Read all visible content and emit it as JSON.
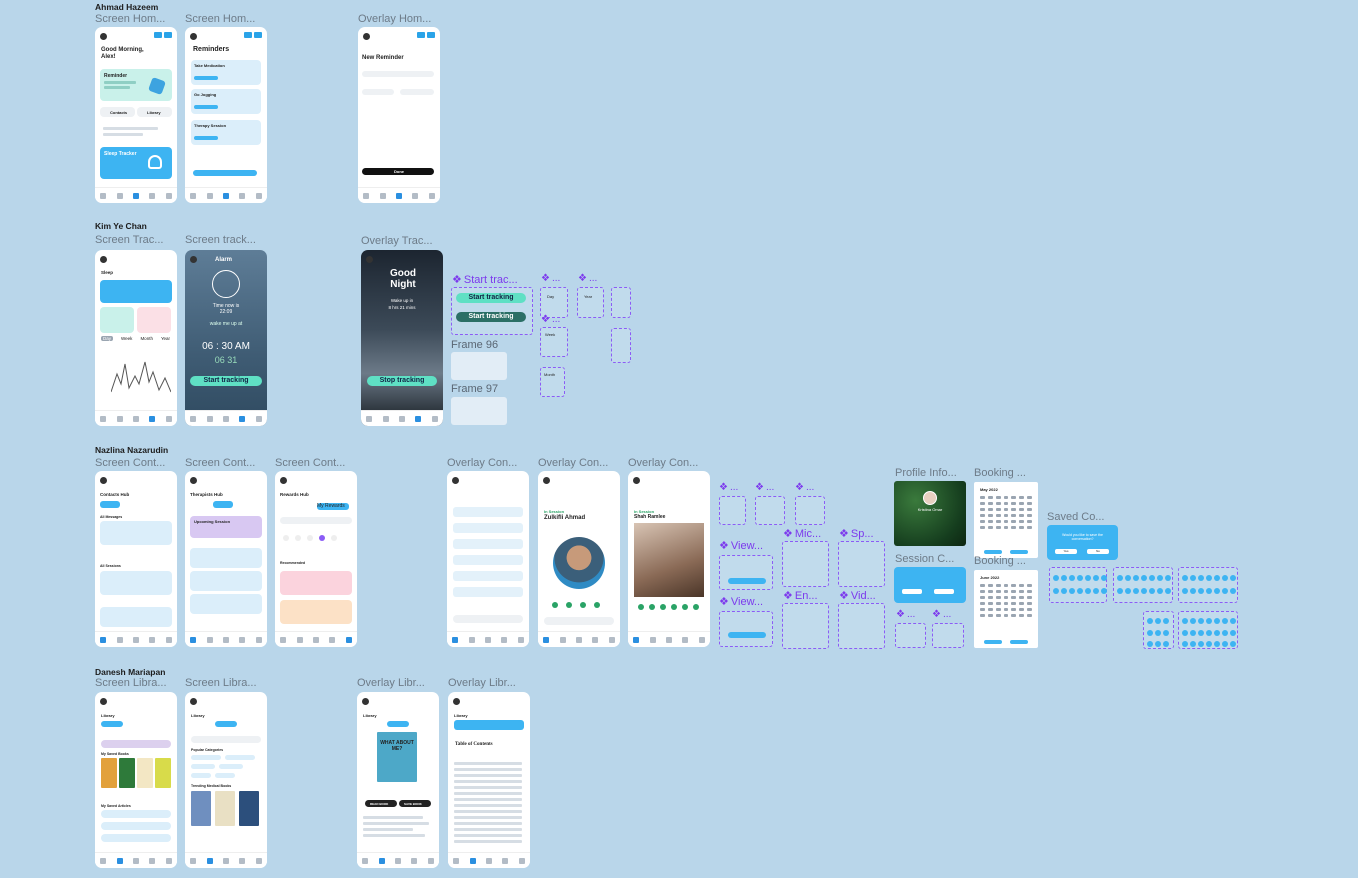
{
  "sections": [
    {
      "designer": "Ahmad Hazeem"
    },
    {
      "designer": "Kim Ye Chan"
    },
    {
      "designer": "Nazlina Nazarudin"
    },
    {
      "designer": "Danesh Mariapan"
    }
  ],
  "labels": {
    "home1": "Screen Hom...",
    "home2": "Screen Hom...",
    "home_overlay": "Overlay Hom...",
    "track1": "Screen Trac...",
    "track2": "Screen track...",
    "track_overlay": "Overlay Trac...",
    "start_track": "Start trac...",
    "frame96": "Frame 96",
    "frame97": "Frame 97",
    "cont1": "Screen Cont...",
    "cont2": "Screen Cont...",
    "cont3": "Screen Cont...",
    "ov_cont1": "Overlay Con...",
    "ov_cont2": "Overlay Con...",
    "ov_cont3": "Overlay Con...",
    "view1": "View...",
    "view2": "View...",
    "mic": "Mic...",
    "end": "En...",
    "speaker": "Sp...",
    "video": "Vid...",
    "profile": "Profile Info...",
    "session": "Session C...",
    "booking1": "Booking ...",
    "booking2": "Booking ...",
    "saved": "Saved Co...",
    "lib1": "Screen Libra...",
    "lib2": "Screen Libra...",
    "ov_lib1": "Overlay Libr...",
    "ov_lib2": "Overlay Libr...",
    "small_a": "...",
    "small_b": "...",
    "small_c": "...",
    "small_d": "..."
  },
  "home": {
    "greeting": "Good Morning, Alex!",
    "reminder": "Reminder",
    "contacts": "Contacts",
    "library": "Library",
    "sleep": "Sleep Tracker",
    "reminders_title": "Reminders",
    "r1": "Take Medication",
    "r2": "Go Jogging",
    "r3": "Therapy Session",
    "new_reminder": "New Reminder",
    "done": "Done"
  },
  "track": {
    "sleep": "Sleep",
    "alarm": "Alarm",
    "time_now": "Time now is",
    "time_now_val": "22:09",
    "wake": "wake me up at",
    "alarm_time": "06 : 30 AM",
    "alarm_next": "06 31",
    "start": "Start tracking",
    "start2": "Start tracking",
    "good_night": "Good Night",
    "wake_up": "Wake up in",
    "hours": "8 hrs 21 mins",
    "stop": "Stop tracking",
    "tabs": [
      "Day",
      "Week",
      "Month",
      "Year"
    ],
    "d": "Day",
    "y": "Year",
    "w": "Week",
    "m": "Month"
  },
  "contacts": {
    "hub": "Contacts Hub",
    "therapists": "Therapists Hub",
    "rewards": "Rewards Hub",
    "messages": "All Messages",
    "sessions": "All Sessions",
    "upcoming": "Upcoming Session",
    "session_name": "Zulkifli Ahmad",
    "in_session": "In Session",
    "in_session2": "In Session",
    "doctor": "Shah Ramlee",
    "recommended": "Recommended",
    "membership": "Membership Details",
    "my_rewards": "My Rewards"
  },
  "profile": {
    "name": "Kristina Omar",
    "month1": "May 2022",
    "month2": "June 2022",
    "saved_q": "Would you like to save the conversation?",
    "yes": "Yes",
    "no": "No"
  },
  "library": {
    "title": "Library",
    "tabs": [
      "Saved Items",
      "Books",
      "Articles"
    ],
    "popular": "Popular Categories",
    "trending": "Trending Medical Books",
    "saved_books": "My Saved Books",
    "saved_articles": "My Saved Articles",
    "contents": "Table of Contents",
    "book_title": "WHAT ABOUT ME?",
    "read_book": "READ BOOK",
    "save_book": "SAVE BOOK"
  }
}
